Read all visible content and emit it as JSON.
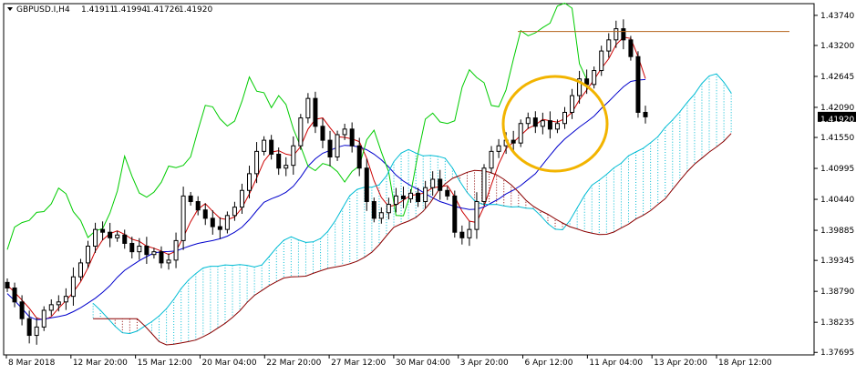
{
  "header": {
    "symbol": "GBPUSD.I,H4",
    "open": "1.41911",
    "high": "1.41994",
    "low": "1.41726",
    "close": "1.41920"
  },
  "chart_data": {
    "type": "candlestick",
    "symbol": "GBPUSD.I",
    "timeframe": "H4",
    "ylim": [
      1.3765,
      1.4395
    ],
    "y_ticks": [
      "1.43740",
      "1.43200",
      "1.42645",
      "1.42090",
      "1.41550",
      "1.40995",
      "1.40440",
      "1.39885",
      "1.39345",
      "1.38790",
      "1.38235",
      "1.37695"
    ],
    "x_ticks": [
      "8 Mar 2018",
      "12 Mar 20:00",
      "15 Mar 12:00",
      "20 Mar 04:00",
      "22 Mar 20:00",
      "27 Mar 12:00",
      "30 Mar 04:00",
      "3 Apr 20:00",
      "6 Apr 12:00",
      "11 Apr 04:00",
      "13 Apr 20:00",
      "18 Apr 12:00"
    ],
    "current_price": "1.41920",
    "resistance_level": 1.4345,
    "close_series": [
      1.3885,
      1.386,
      1.383,
      1.38,
      1.3815,
      1.3845,
      1.3855,
      1.386,
      1.387,
      1.3905,
      1.393,
      1.396,
      1.399,
      1.3985,
      1.3975,
      1.398,
      1.3965,
      1.395,
      1.396,
      1.3945,
      1.395,
      1.393,
      1.3935,
      1.397,
      1.405,
      1.404,
      1.4025,
      1.401,
      1.3995,
      1.399,
      1.4015,
      1.403,
      1.406,
      1.409,
      1.413,
      1.415,
      1.4125,
      1.41,
      1.4105,
      1.414,
      1.419,
      1.4225,
      1.4175,
      1.415,
      1.412,
      1.416,
      1.417,
      1.414,
      1.41,
      1.404,
      1.401,
      1.402,
      1.4035,
      1.405,
      1.4045,
      1.4055,
      1.404,
      1.4065,
      1.408,
      1.406,
      1.405,
      1.3985,
      1.3975,
      1.399,
      1.404,
      1.41,
      1.413,
      1.414,
      1.415,
      1.4145,
      1.418,
      1.419,
      1.4175,
      1.4185,
      1.417,
      1.418,
      1.42,
      1.423,
      1.426,
      1.425,
      1.4275,
      1.431,
      1.433,
      1.435,
      1.433,
      1.43,
      1.42,
      1.4192
    ],
    "series": [
      {
        "name": "Tenkan-sen",
        "color": "#cc0000"
      },
      {
        "name": "Kijun-sen",
        "color": "#0000cc"
      },
      {
        "name": "Chikou Span",
        "color": "#00cc00"
      },
      {
        "name": "Senkou Span A",
        "color": "#00bcd4"
      },
      {
        "name": "Senkou Span B",
        "color": "#8b0000"
      }
    ],
    "annotation": "ellipse",
    "annotation_color": "#f2b400"
  }
}
